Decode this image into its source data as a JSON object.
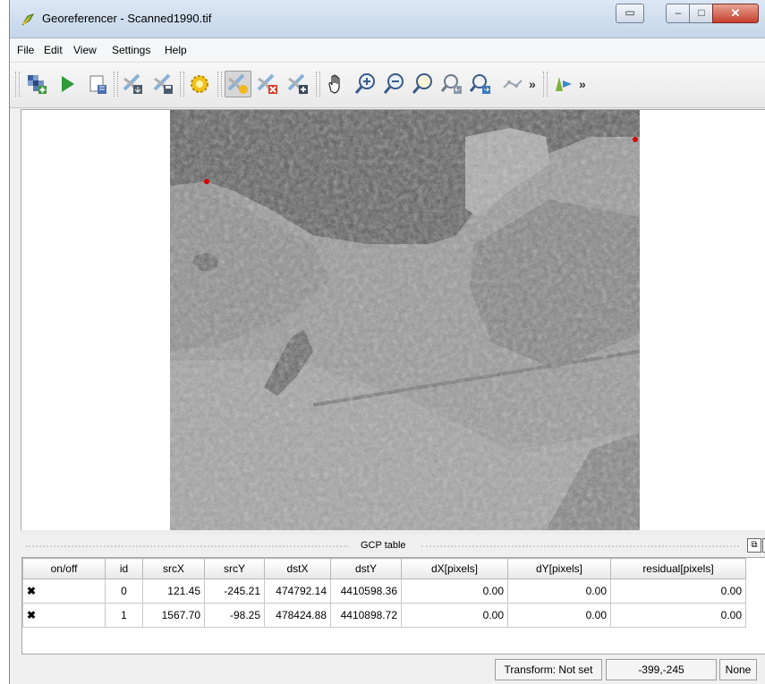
{
  "window": {
    "title": "Georeferencer - Scanned1990.tif"
  },
  "menu": {
    "items": [
      "File",
      "Edit",
      "View",
      "Settings",
      "Help"
    ]
  },
  "toolbar": {
    "icons": [
      "open-raster-icon",
      "start-georeferencing-icon",
      "generate-gdal-script-icon",
      "load-gcp-points-icon",
      "save-gcp-points-icon",
      "transformation-settings-icon",
      "add-point-icon",
      "delete-point-icon",
      "move-gcp-point-icon",
      "pan-icon",
      "zoom-in-icon",
      "zoom-out-icon",
      "zoom-to-layer-icon",
      "zoom-last-icon",
      "zoom-next-icon",
      "link-georeferencer-to-qgis-icon",
      "link-qgis-to-georeferencer-icon"
    ],
    "overflow_label": "»"
  },
  "gcp_panel": {
    "title": "GCP table",
    "columns": [
      "on/off",
      "id",
      "srcX",
      "srcY",
      "dstX",
      "dstY",
      "dX[pixels]",
      "dY[pixels]",
      "residual[pixels]"
    ],
    "rows": [
      {
        "enabled": "✖",
        "id": "0",
        "srcX": "121.45",
        "srcY": "-245.21",
        "dstX": "474792.14",
        "dstY": "4410598.36",
        "dX": "0.00",
        "dY": "0.00",
        "residual": "0.00"
      },
      {
        "enabled": "✖",
        "id": "1",
        "srcX": "1567.70",
        "srcY": "-98.25",
        "dstX": "478424.88",
        "dstY": "4410898.72",
        "dX": "0.00",
        "dY": "0.00",
        "residual": "0.00"
      }
    ]
  },
  "status": {
    "transform": "Transform: Not set",
    "coords": "-399,-245",
    "crs": "None"
  }
}
